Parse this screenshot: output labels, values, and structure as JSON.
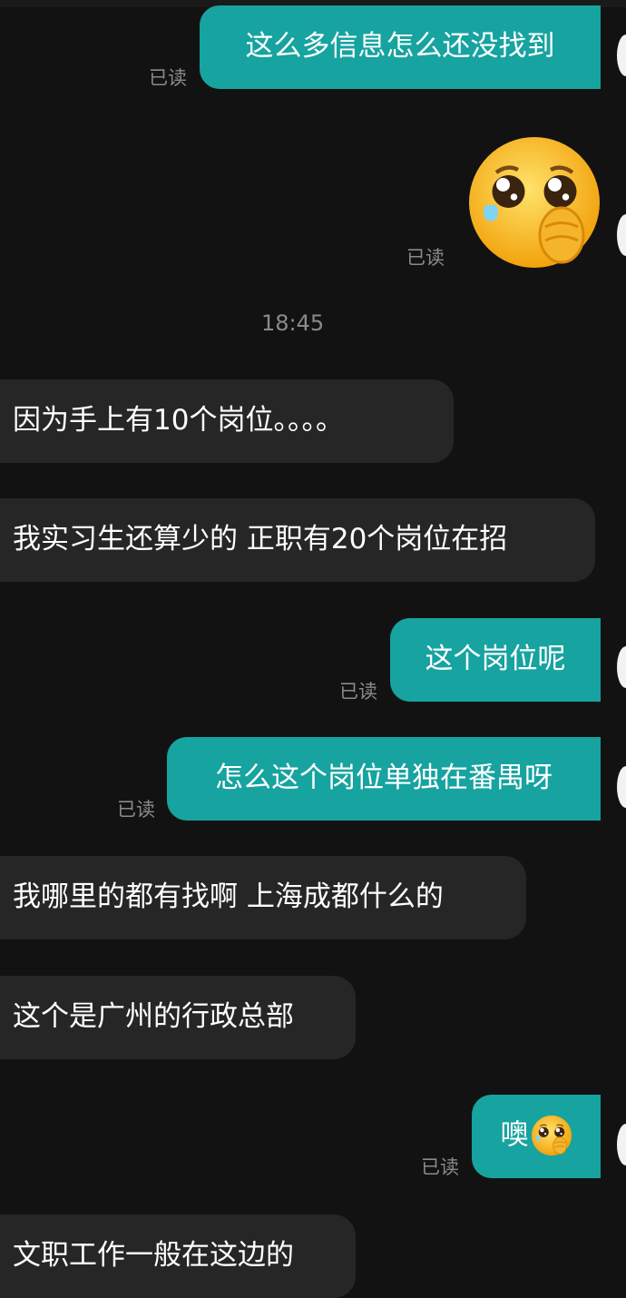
{
  "messages": [
    {
      "side": "out",
      "text": "这么多信息怎么还没找到",
      "read": "已读"
    },
    {
      "side": "out",
      "emoji": "crying-emoji",
      "read": "已读"
    },
    {
      "side": "in",
      "text": "因为手上有10个岗位。。。。"
    },
    {
      "side": "in",
      "text": "我实习生还算少的 正职有20个岗位在招"
    },
    {
      "side": "out",
      "text": "这个岗位呢",
      "read": "已读"
    },
    {
      "side": "out",
      "text": "怎么这个岗位单独在番禺呀",
      "read": "已读"
    },
    {
      "side": "in",
      "text": "我哪里的都有找啊 上海成都什么的"
    },
    {
      "side": "in",
      "text": "这个是广州的行政总部"
    },
    {
      "side": "out",
      "text": "噢",
      "emoji": "crying-emoji",
      "read": "已读"
    },
    {
      "side": "in",
      "text": "文职工作一般在这边的"
    }
  ],
  "timestamp": "18:45",
  "colors": {
    "background": "#121212",
    "outgoing_bubble": "#17a3a0",
    "incoming_bubble": "#262626",
    "muted_text": "#8a8a8a"
  }
}
